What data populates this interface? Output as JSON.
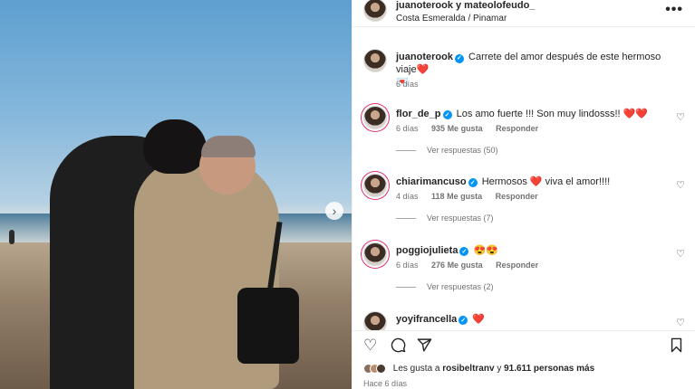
{
  "post": {
    "header": {
      "users": "juanoterook y mateolofeudo_",
      "location": "Costa Esmeralda / Pinamar",
      "more_icon": "more-icon"
    },
    "caption": {
      "username": "juanoterook",
      "text": "Carrete del amor después de este hermoso viaje",
      "emoji_heart": "❤️",
      "emoji_envelope": "💌",
      "time": "6 días"
    },
    "comments": [
      {
        "username": "flor_de_p",
        "text": "Los amo fuerte !!! Son muy lindosss!!",
        "emoji": "❤️❤️",
        "time": "6 días",
        "likes": "935 Me gusta",
        "reply": "Responder",
        "replies": "Ver respuestas (50)"
      },
      {
        "username": "chiarimancuso",
        "text_before": "Hermosos",
        "emoji": "❤️",
        "text_after": "viva el amor!!!!",
        "time": "4 días",
        "likes": "118 Me gusta",
        "reply": "Responder",
        "replies": "Ver respuestas (7)"
      },
      {
        "username": "poggiojulieta",
        "emoji": "😍😍",
        "time": "6 días",
        "likes": "276 Me gusta",
        "reply": "Responder",
        "replies": "Ver respuestas (2)"
      },
      {
        "username": "yoyifrancella",
        "emoji": "❤️"
      }
    ],
    "actions": {
      "like_icon": "heart-outline-icon",
      "comment_icon": "comment-icon",
      "share_icon": "share-icon",
      "save_icon": "bookmark-icon"
    },
    "likes": {
      "prefix": "Les gusta a",
      "user": "rosibeltranv",
      "middle": "y",
      "count": "91.611 personas más"
    },
    "time_ago": "Hace 6 días"
  },
  "colors": {
    "verified": "#0095f6",
    "heart": "#ed1c3c",
    "muted_text": "#737373"
  }
}
